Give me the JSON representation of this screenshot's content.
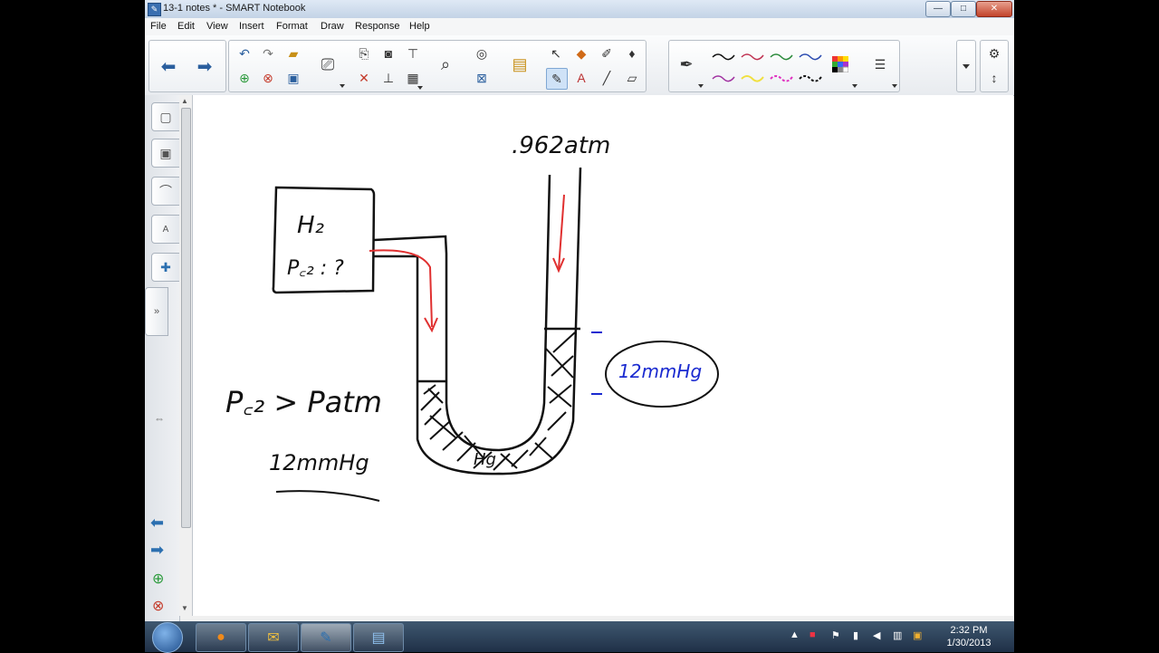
{
  "window": {
    "title": "13-1 notes * - SMART Notebook",
    "min_glyph": "—",
    "max_glyph": "□",
    "close_glyph": "✕"
  },
  "menu": [
    "File",
    "Edit",
    "View",
    "Insert",
    "Format",
    "Draw",
    "Response",
    "Help"
  ],
  "toolbar_icons": {
    "back": "back-arrow-icon",
    "forward": "forward-arrow-icon",
    "undo": "undo-icon",
    "redo": "redo-icon",
    "open": "open-folder-icon",
    "add_page": "add-page-icon",
    "delete_page": "delete-page-icon",
    "save": "save-icon",
    "pen": "pen-icon",
    "select": "select-arrow-icon",
    "text": "text-icon",
    "line": "line-icon",
    "eraser": "eraser-icon"
  },
  "drawing": {
    "top_pressure": ".962atm",
    "flask_gas": "H₂",
    "flask_pressure": "P꜀₂ : ?",
    "relation": "P꜀₂ > Patm",
    "difference": "12mmHg",
    "bracket_label": "12mmHg",
    "mercury_label": "Hg"
  },
  "clock": {
    "time": "2:32 PM",
    "date": "1/30/2013"
  },
  "colors": {
    "ink": "#111111",
    "arrow": "#e03030",
    "bracket": "#1a2ad0"
  }
}
